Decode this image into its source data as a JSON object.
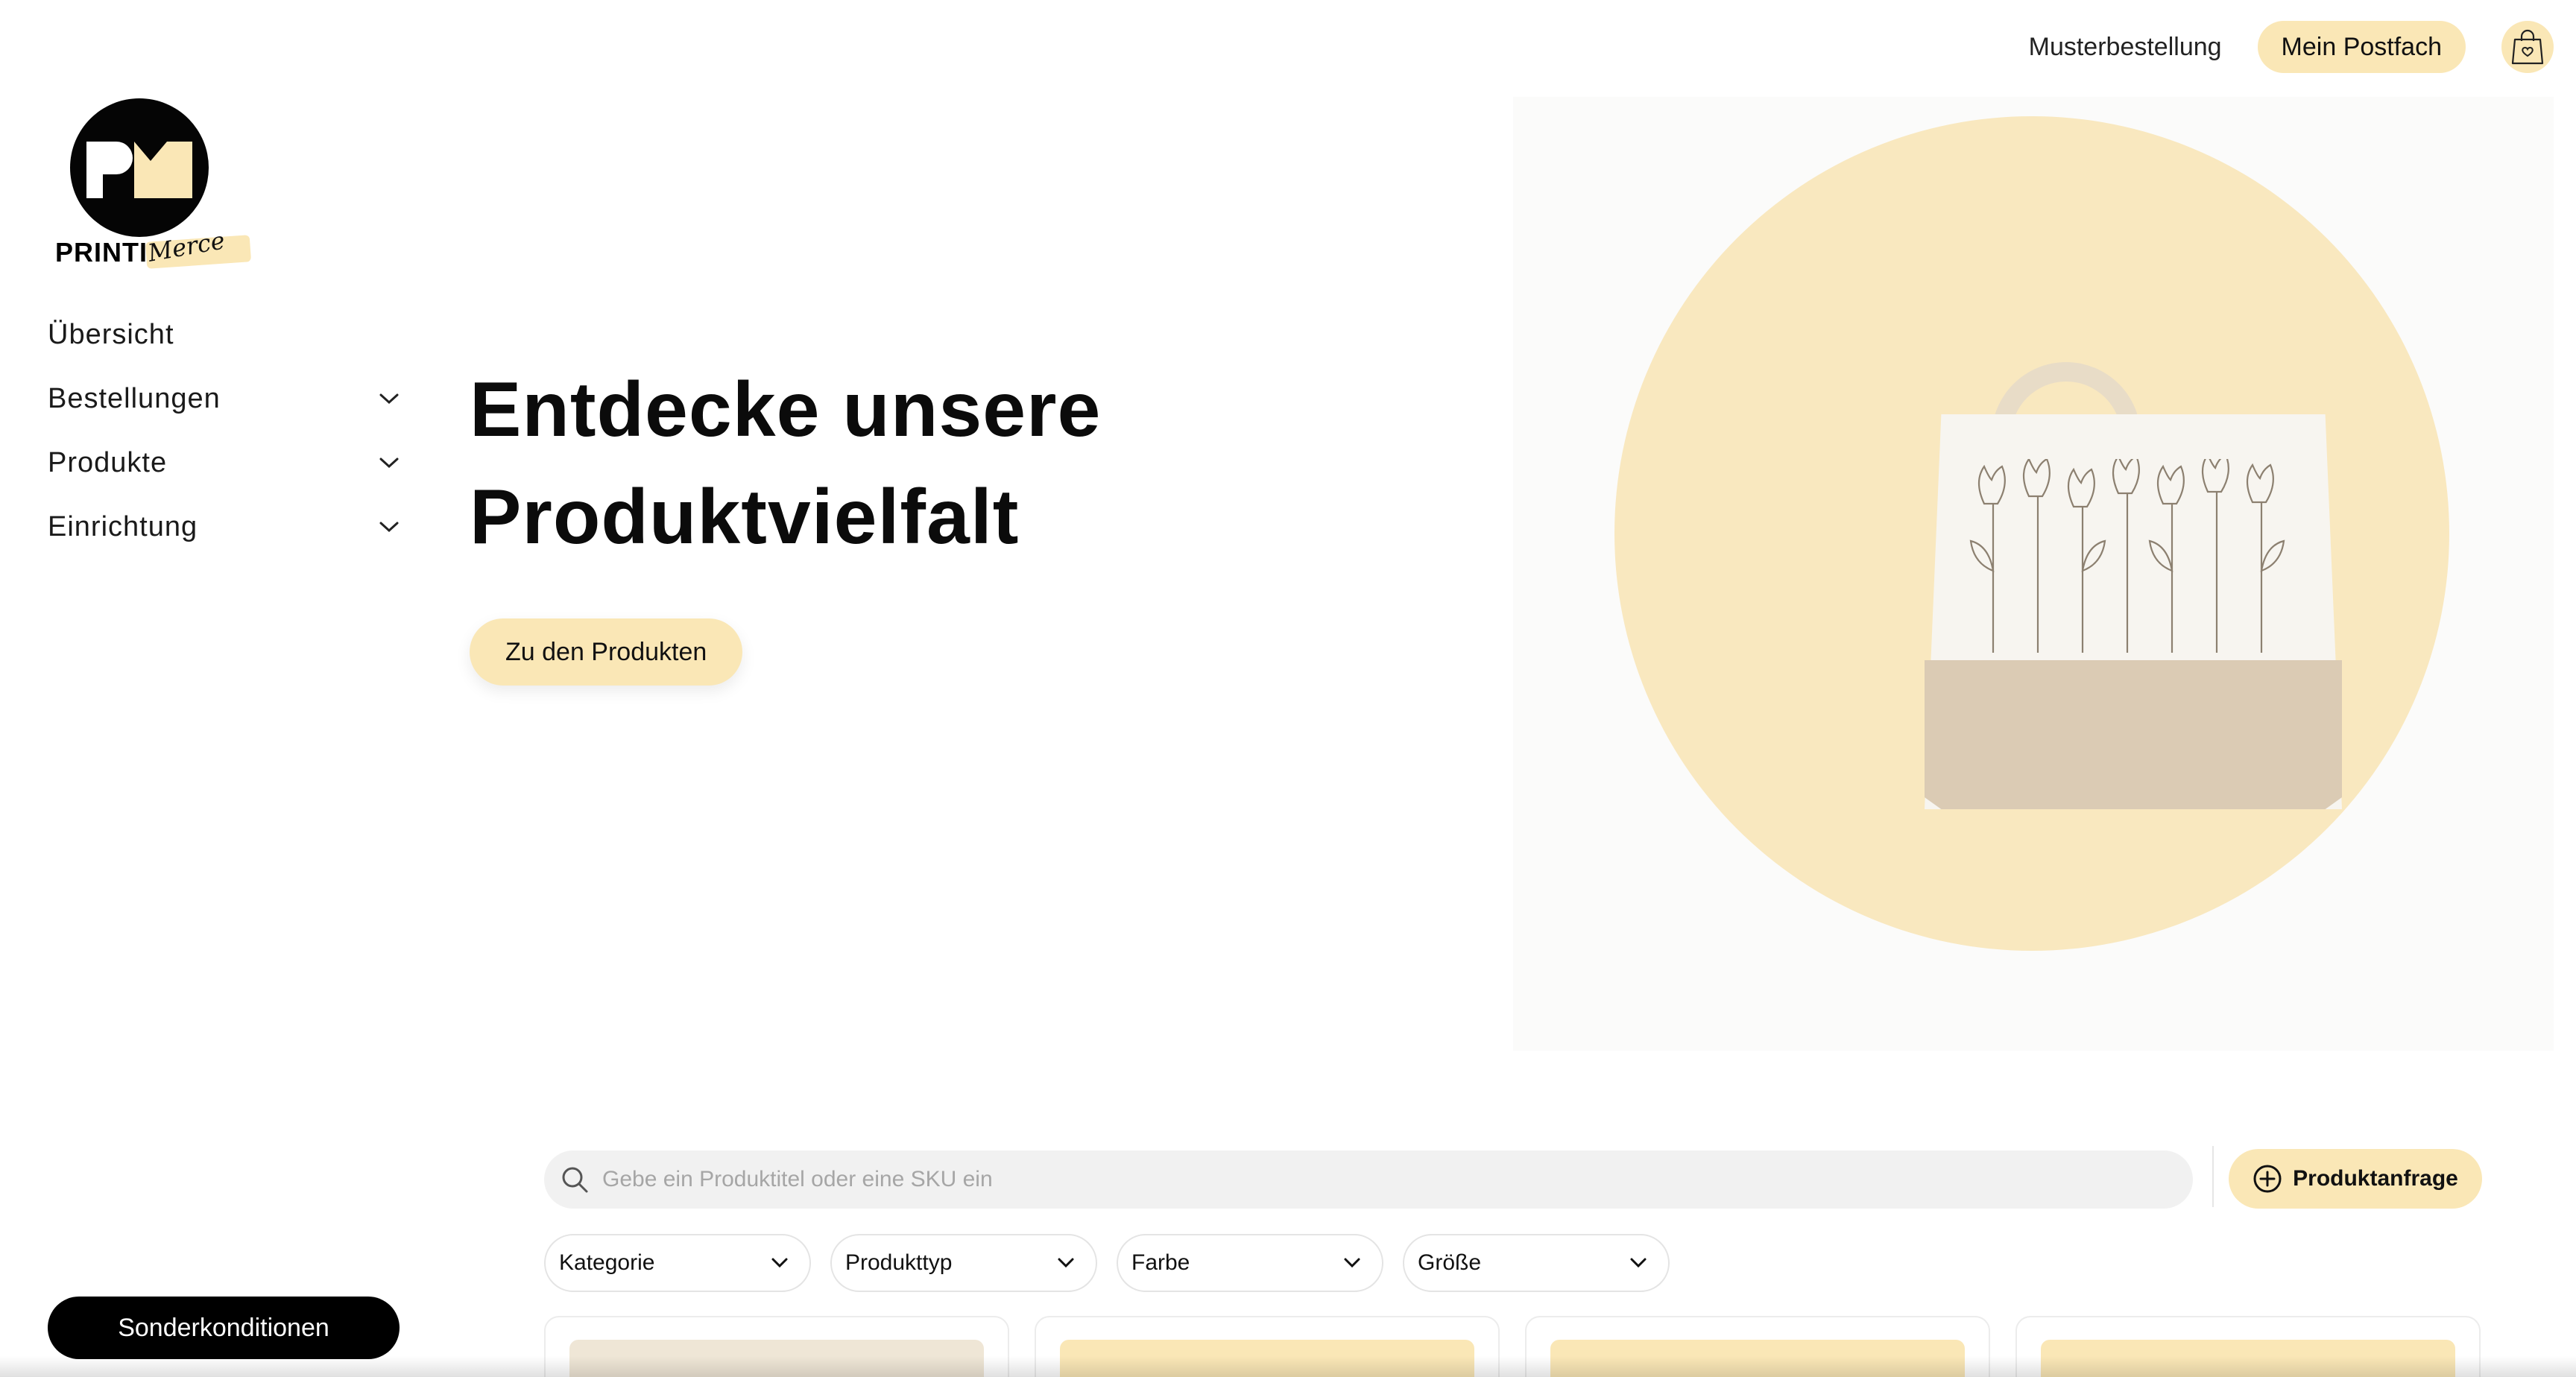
{
  "brand": {
    "logo_text": "PRINTI",
    "logo_script": "Merce",
    "logo_mark": "PM"
  },
  "sidebar": {
    "items": [
      {
        "label": "Übersicht",
        "has_submenu": false
      },
      {
        "label": "Bestellungen",
        "has_submenu": true
      },
      {
        "label": "Produkte",
        "has_submenu": true
      },
      {
        "label": "Einrichtung",
        "has_submenu": true
      }
    ],
    "special_button": "Sonderkonditionen"
  },
  "header": {
    "sample_order_link": "Musterbestellung",
    "inbox_button": "Mein Postfach",
    "cart_icon": "shopping-bag-icon"
  },
  "hero": {
    "title_line1": "Entdecke unsere",
    "title_line2": "Produktvielfalt",
    "cta": "Zu den Produkten",
    "image": "tote-bag-image"
  },
  "search": {
    "placeholder": "Gebe ein Produktitel oder eine SKU ein",
    "value": ""
  },
  "product_request_button": "Produktanfrage",
  "filters": [
    {
      "label": "Kategorie"
    },
    {
      "label": "Produkttyp"
    },
    {
      "label": "Farbe"
    },
    {
      "label": "Größe"
    }
  ],
  "colors": {
    "accent": "#fae7b6",
    "dark": "#000000",
    "hero_circle": "#f9e8bf"
  }
}
